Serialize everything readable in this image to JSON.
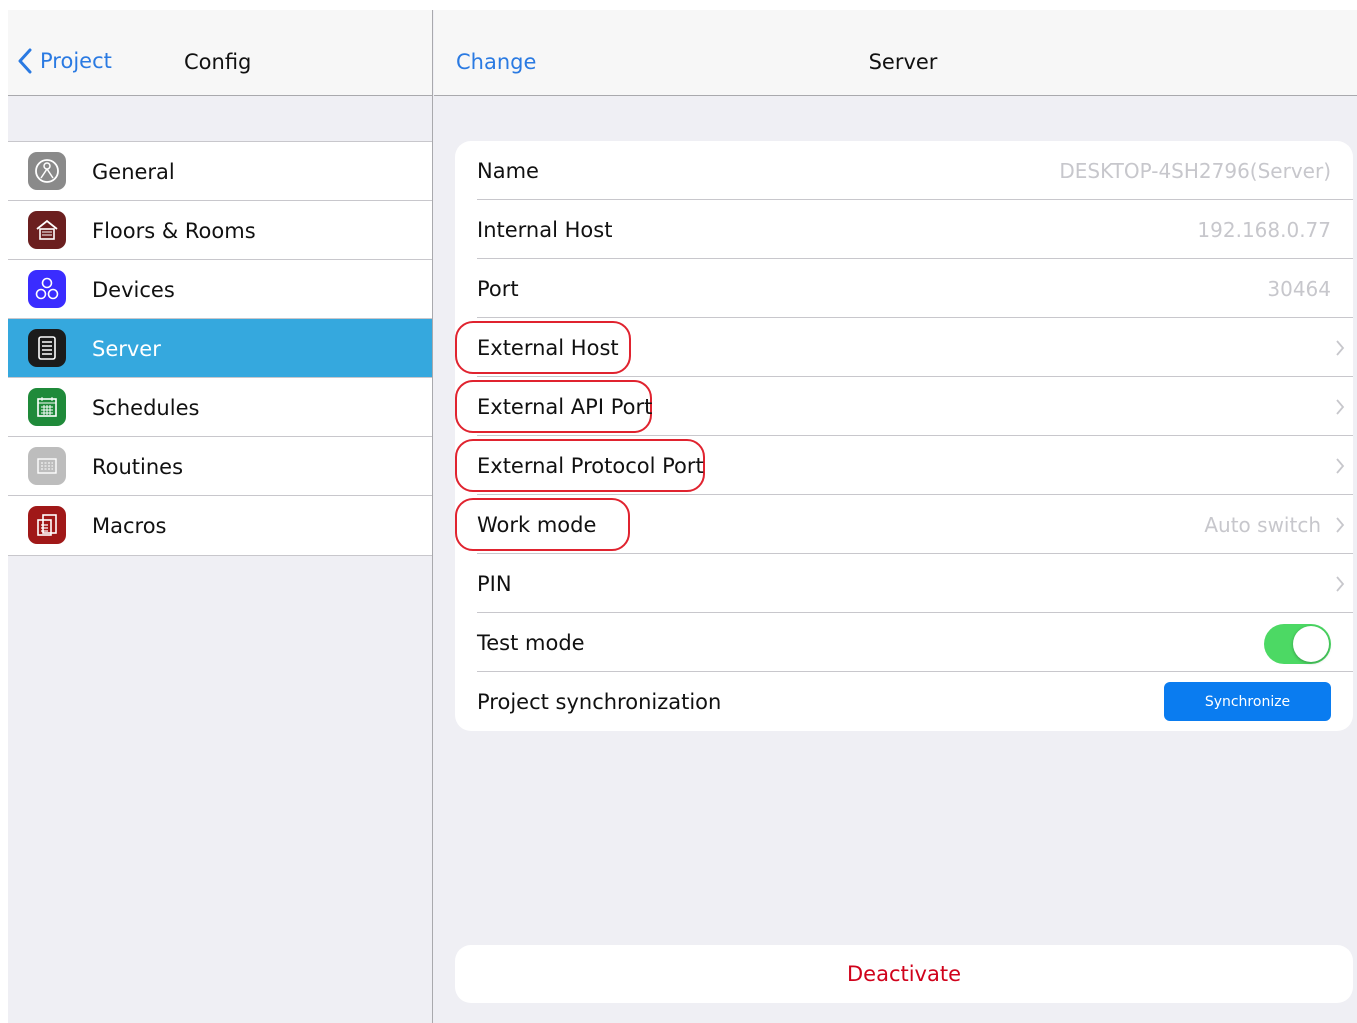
{
  "left_pane": {
    "back_label": "Project",
    "title": "Config",
    "menu": [
      {
        "label": "General",
        "icon": "compass-icon",
        "color": "#8a8a8a",
        "active": false
      },
      {
        "label": "Floors & Rooms",
        "icon": "house-icon",
        "color": "#6b1f1f",
        "active": false
      },
      {
        "label": "Devices",
        "icon": "devices-icon",
        "color": "#3a2cff",
        "active": false
      },
      {
        "label": "Server",
        "icon": "server-icon",
        "color": "#1b1b1b",
        "active": true
      },
      {
        "label": "Schedules",
        "icon": "calendar-icon",
        "color": "#1f8a3a",
        "active": false
      },
      {
        "label": "Routines",
        "icon": "routines-icon",
        "color": "#bdbdbd",
        "active": false
      },
      {
        "label": "Macros",
        "icon": "macros-icon",
        "color": "#a01818",
        "active": false
      }
    ]
  },
  "right_pane": {
    "left_action": "Change",
    "title": "Server",
    "rows": [
      {
        "label": "Name",
        "value": "DESKTOP-4SH2796(Server)"
      },
      {
        "label": "Internal Host",
        "value": "192.168.0.77"
      },
      {
        "label": "Port",
        "value": "30464"
      },
      {
        "label": "External Host",
        "value": ""
      },
      {
        "label": "External API Port",
        "value": ""
      },
      {
        "label": "External Protocol Port",
        "value": ""
      },
      {
        "label": "Work mode",
        "value": "Auto switch"
      },
      {
        "label": "PIN",
        "value": ""
      },
      {
        "label": "Test mode",
        "toggle_on": true
      },
      {
        "label": "Project synchronization",
        "button_label": "Synchronize"
      }
    ],
    "deactivate_label": "Deactivate"
  },
  "colors": {
    "accent": "#2a7ae2",
    "selected_row": "#35a8de",
    "toggle_on": "#4cd964",
    "sync_button": "#0a7cf0",
    "destructive": "#d0021b",
    "highlight_outline": "#e0232f"
  }
}
